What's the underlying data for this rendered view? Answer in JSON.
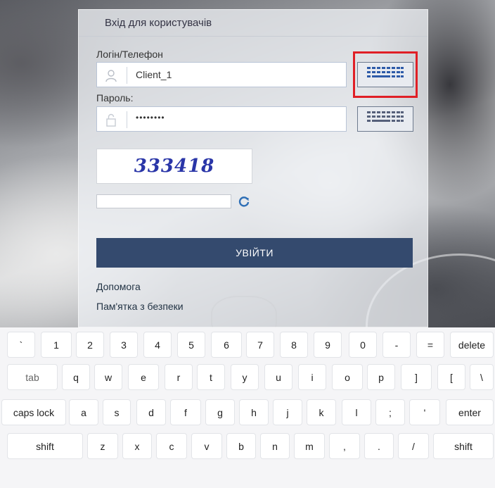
{
  "login": {
    "title": "Вхід для користувачів",
    "login_label": "Логін/Телефон",
    "login_value": "Client_1",
    "password_label": "Пароль:",
    "password_value": "••••••••",
    "captcha_text": "333418",
    "captcha_input_value": "",
    "submit_label": "УВІЙТИ",
    "help_link": "Допомога",
    "security_link": "Пам'ятка з безпеки"
  },
  "icons": {
    "user": "user-icon",
    "lock": "lock-icon",
    "keyboard": "keyboard-icon",
    "refresh": "refresh-icon"
  },
  "colors": {
    "submit_bg": "#344a6e",
    "highlight": "#e01f26",
    "keyboard_icon": "#2d5aa8"
  },
  "keyboard": {
    "rows": [
      [
        "`",
        "1",
        "2",
        "3",
        "4",
        "5",
        "6",
        "7",
        "8",
        "9",
        "0",
        "-",
        "=",
        "delete"
      ],
      [
        "tab",
        "q",
        "w",
        "e",
        "r",
        "t",
        "y",
        "u",
        "i",
        "o",
        "p",
        "]",
        "[",
        "\\"
      ],
      [
        "caps lock",
        "a",
        "s",
        "d",
        "f",
        "g",
        "h",
        "j",
        "k",
        "l",
        ";",
        "'",
        "enter"
      ],
      [
        "shift",
        "z",
        "x",
        "c",
        "v",
        "b",
        "n",
        "m",
        ",",
        ".",
        "/",
        "shift"
      ]
    ]
  }
}
